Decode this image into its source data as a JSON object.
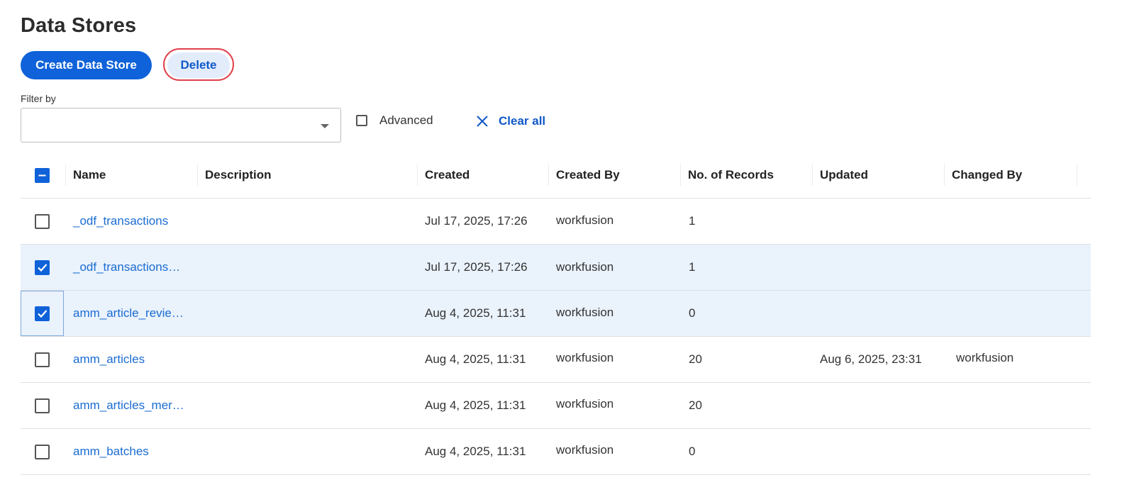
{
  "page": {
    "title": "Data Stores"
  },
  "toolbar": {
    "create_label": "Create Data Store",
    "delete_label": "Delete"
  },
  "filter": {
    "label": "Filter by",
    "value": "",
    "advanced_label": "Advanced",
    "advanced_checked": false,
    "clear_all_label": "Clear all"
  },
  "table": {
    "header_checkbox_state": "indeterminate",
    "columns": [
      "Name",
      "Description",
      "Created",
      "Created By",
      "No. of Records",
      "Updated",
      "Changed By"
    ],
    "rows": [
      {
        "checked": false,
        "name": "_odf_transactions",
        "description": "",
        "created": "Jul 17, 2025, 17:26",
        "created_by": "workfusion",
        "records": "1",
        "updated": "",
        "changed_by": ""
      },
      {
        "checked": true,
        "name": "_odf_transactions…",
        "description": "",
        "created": "Jul 17, 2025, 17:26",
        "created_by": "workfusion",
        "records": "1",
        "updated": "",
        "changed_by": ""
      },
      {
        "checked": true,
        "name": "amm_article_revie…",
        "description": "",
        "created": "Aug 4, 2025, 11:31",
        "created_by": "workfusion",
        "records": "0",
        "updated": "",
        "changed_by": ""
      },
      {
        "checked": false,
        "name": "amm_articles",
        "description": "",
        "created": "Aug 4, 2025, 11:31",
        "created_by": "workfusion",
        "records": "20",
        "updated": "Aug 6, 2025, 23:31",
        "changed_by": "workfusion"
      },
      {
        "checked": false,
        "name": "amm_articles_mer…",
        "description": "",
        "created": "Aug 4, 2025, 11:31",
        "created_by": "workfusion",
        "records": "20",
        "updated": "",
        "changed_by": ""
      },
      {
        "checked": false,
        "name": "amm_batches",
        "description": "",
        "created": "Aug 4, 2025, 11:31",
        "created_by": "workfusion",
        "records": "0",
        "updated": "",
        "changed_by": ""
      }
    ]
  },
  "colors": {
    "accent": "#0f62d9",
    "link": "#1a6cd1",
    "selected_row": "#eaf2fc",
    "highlight_ring": "#e0404a"
  },
  "icons": {
    "filter_caret": "chevron-down-icon",
    "clear": "close-icon",
    "check": "check-icon",
    "indeterminate": "minus-icon"
  }
}
